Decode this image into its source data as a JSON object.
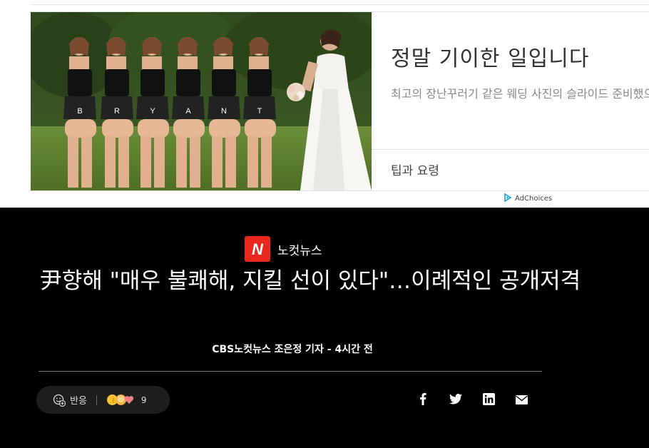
{
  "ad": {
    "image_alt": "bridesmaids prank wedding photo",
    "title": "정말 기이한 일입니다",
    "description": "최고의 장난꾸러기 같은 웨딩 사진의 슬라이드 준비했으니",
    "source": "팁과 요령",
    "adchoices_label": "AdChoices",
    "skirt_letters": [
      "B",
      "R",
      "Y",
      "A",
      "N",
      "T"
    ]
  },
  "article": {
    "brand_logo_letter": "N",
    "brand_name": "노컷뉴스",
    "headline": "尹향해 \"매우 불쾌해, 지킬 선이 있다\"…이례적인 공개저격",
    "byline": "CBS노컷뉴스 조은정 기자 - 4시간 전",
    "reaction_label": "반응",
    "reaction_count": "9",
    "reaction_emojis": [
      "thumbs-up",
      "laughing",
      "heart"
    ],
    "share_icons": [
      "facebook-icon",
      "twitter-icon",
      "linkedin-icon",
      "email-icon"
    ]
  },
  "colors": {
    "brand_red": "#e8281e",
    "background": "#000000"
  }
}
